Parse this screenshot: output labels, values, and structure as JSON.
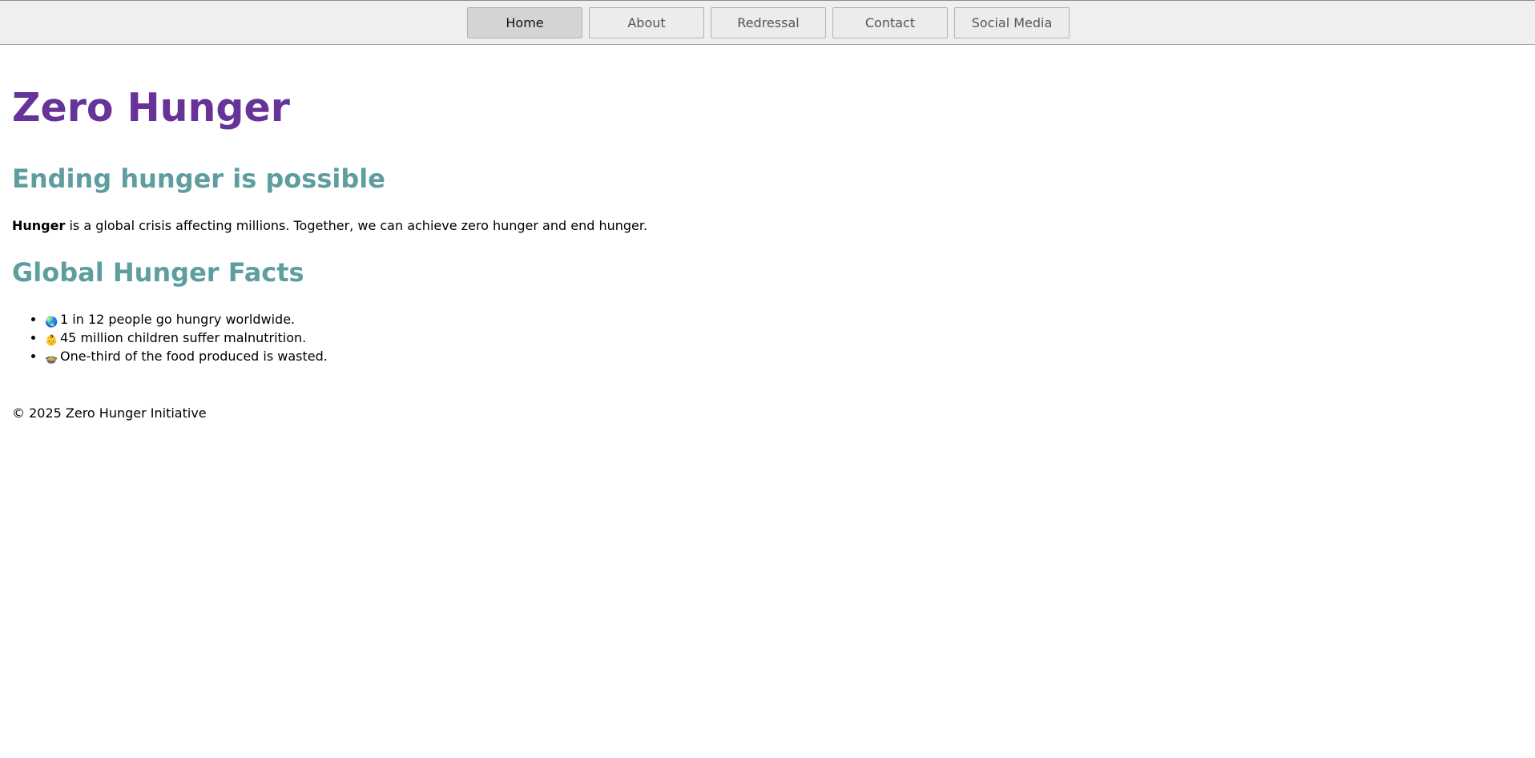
{
  "nav": {
    "items": [
      {
        "label": "Home",
        "active": true
      },
      {
        "label": "About",
        "active": false
      },
      {
        "label": "Redressal",
        "active": false
      },
      {
        "label": "Contact",
        "active": false
      },
      {
        "label": "Social Media",
        "active": false
      }
    ]
  },
  "main": {
    "title": "Zero Hunger",
    "heading_1": "Ending hunger is possible",
    "intro_bold": "Hunger",
    "intro_rest": " is a global crisis affecting millions. Together, we can achieve zero hunger and end hunger.",
    "heading_2": "Global Hunger Facts",
    "facts": [
      {
        "icon": "globe-icon",
        "glyph": "🌏",
        "text": "1 in 12 people go hungry worldwide."
      },
      {
        "icon": "baby-icon",
        "glyph": "👶",
        "text": "45 million children suffer malnutrition."
      },
      {
        "icon": "food-bowl-icon",
        "glyph": "🍲",
        "text": "One-third of the food produced is wasted."
      }
    ]
  },
  "footer": {
    "text": "© 2025 Zero Hunger Initiative"
  },
  "colors": {
    "title": "#663399",
    "heading": "#5f9ea0",
    "nav_bg": "#efefef",
    "nav_active": "#d4d4d4"
  }
}
